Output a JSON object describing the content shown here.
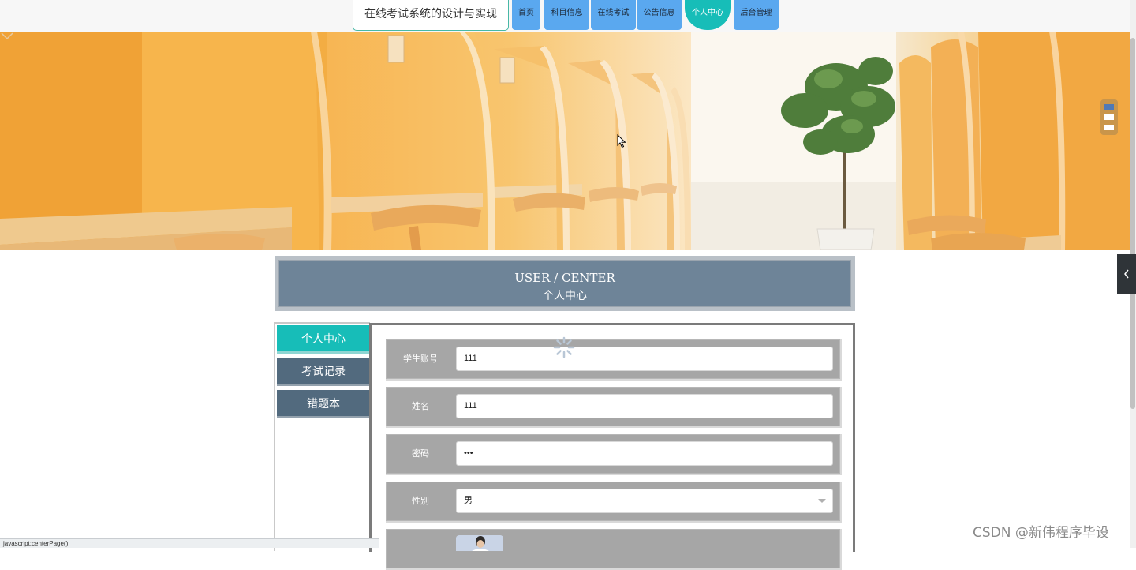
{
  "header": {
    "site_title": "在线考试系统的设计与实现",
    "nav": [
      {
        "label": "首页"
      },
      {
        "label": "科目信息"
      },
      {
        "label": "在线考试"
      },
      {
        "label": "公告信息"
      },
      {
        "label": "个人中心",
        "active": true
      },
      {
        "label": "后台管理"
      }
    ]
  },
  "banner": {
    "slide_count": 3,
    "current_slide": 1,
    "icons": [
      "chevron-down-icon"
    ]
  },
  "section": {
    "title_en": "USER / CENTER",
    "title_cn": "个人中心"
  },
  "sidebar": {
    "items": [
      {
        "label": "个人中心",
        "active": true
      },
      {
        "label": "考试记录"
      },
      {
        "label": "错题本"
      }
    ]
  },
  "form": {
    "fields": [
      {
        "label": "学生账号",
        "value": "111"
      },
      {
        "label": "姓名",
        "value": "111"
      },
      {
        "label": "密码",
        "value": "•••"
      },
      {
        "label": "性别",
        "value": "男"
      }
    ]
  },
  "status_bar": {
    "text": "javascript:centerPage();"
  },
  "watermark": {
    "text": "CSDN @新伟程序毕设"
  },
  "colors": {
    "nav_blue": "#5aa8ef",
    "accent_teal": "#17bdb8",
    "menu_slate": "#526a7e",
    "header_slate": "#6e8498",
    "field_gray": "#a6a6a6"
  }
}
